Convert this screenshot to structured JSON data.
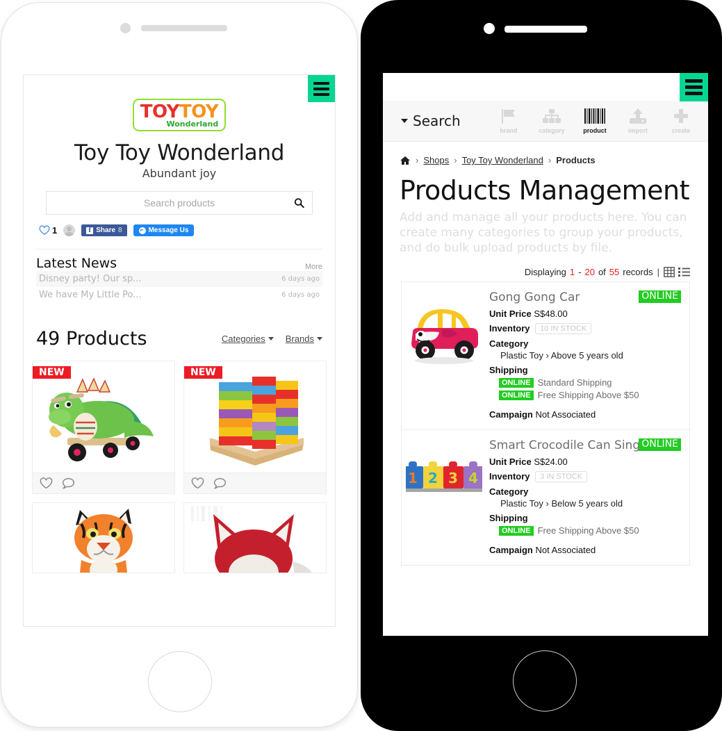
{
  "left_phone": {
    "device": "white-phone",
    "shop": {
      "logo": {
        "word1": "TOY",
        "word2": "TOY",
        "subtitle": "Wonderland",
        "border_color": "#8fe02a",
        "color1": "#e8302a",
        "color2": "#f5921e",
        "sub_color": "#2fa82f"
      },
      "title": "Toy Toy Wonderland",
      "tagline": "Abundant joy"
    },
    "search": {
      "placeholder": "Search products",
      "value": "",
      "icon": "search-icon"
    },
    "social": {
      "like_count": "1",
      "facebook_share_label": "Share",
      "facebook_share_count": "8",
      "facebook_color": "#3b5998",
      "message_label": "Message Us",
      "message_color": "#1f87f0"
    },
    "news": {
      "heading": "Latest News",
      "more_label": "More",
      "items": [
        {
          "text": "Disney party! Our sp...",
          "time": "6 days ago"
        },
        {
          "text": "We have My Little Po...",
          "time": "6 days ago"
        }
      ]
    },
    "products": {
      "count_label": "49 Products",
      "filters": [
        {
          "label": "Categories"
        },
        {
          "label": "Brands"
        }
      ],
      "new_badge": "NEW",
      "cards": [
        {
          "alt": "green-dragon-ride-on-toy",
          "badge": "NEW"
        },
        {
          "alt": "rainbow-wooden-block-stack",
          "badge": "NEW"
        },
        {
          "alt": "tiger-plush-toy",
          "badge": ""
        },
        {
          "alt": "red-fox-plush-toy",
          "badge": ""
        }
      ]
    },
    "menu_color": "#06d692"
  },
  "right_phone": {
    "device": "black-phone",
    "toolbar": {
      "search_label": "Search",
      "icons": [
        {
          "name": "brand-icon",
          "label": "brand",
          "active": false
        },
        {
          "name": "category-icon",
          "label": "category",
          "active": false
        },
        {
          "name": "barcode-product-icon",
          "label": "product",
          "active": true
        },
        {
          "name": "import-upload-icon",
          "label": "import",
          "active": false
        },
        {
          "name": "create-plus-icon",
          "label": "create",
          "active": false
        }
      ]
    },
    "breadcrumb": {
      "home_icon": "home-icon",
      "items": [
        {
          "label": "Shops",
          "link": true
        },
        {
          "label": "Toy Toy Wonderland",
          "link": true
        },
        {
          "label": "Products",
          "link": false
        }
      ],
      "separator": "›"
    },
    "page": {
      "title": "Products Management",
      "description": "Add and manage all your products here. You can create many categories to group your products, and do bulk upload products by file."
    },
    "displaying": {
      "prefix": "Displaying",
      "from": "1",
      "dash": "-",
      "to": "20",
      "of": "of",
      "total": "55",
      "suffix": "records",
      "pipe": "|",
      "grid_view_icon": "grid-view-icon",
      "list_view_icon": "list-view-icon",
      "highlight_color": "#f01b1b"
    },
    "labels": {
      "unit_price": "Unit Price",
      "inventory": "Inventory",
      "category": "Category",
      "shipping": "Shipping",
      "campaign": "Campaign"
    },
    "products": [
      {
        "name": "Gong Gong Car",
        "thumb": "pink-yellow-ride-on-car",
        "status": "ONLINE",
        "unit_price": "S$48.00",
        "inventory": "10 IN STOCK",
        "category": "Plastic Toy › Above 5 years old",
        "shipping": [
          {
            "status": "ONLINE",
            "name": "Standard Shipping"
          },
          {
            "status": "ONLINE",
            "name": "Free Shipping Above $50"
          }
        ],
        "campaign": "Not Associated"
      },
      {
        "name": "Smart Crocodile Can Sing",
        "thumb": "numbered-blocks-1234",
        "status": "ONLINE",
        "unit_price": "S$24.00",
        "inventory": "3 IN STOCK",
        "category": "Plastic Toy › Below 5 years old",
        "shipping": [
          {
            "status": "ONLINE",
            "name": "Free Shipping Above $50"
          }
        ],
        "campaign": "Not Associated"
      }
    ],
    "menu_color": "#06d692",
    "online_color": "#22cc22"
  }
}
